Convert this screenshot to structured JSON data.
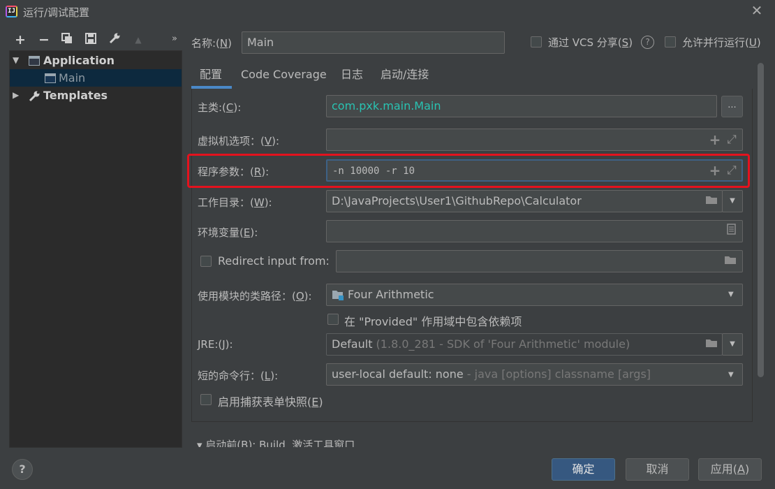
{
  "window": {
    "title": "运行/调试配置",
    "app_icon_text": "IJ"
  },
  "toolbar": {
    "add": "+",
    "remove": "−",
    "copy": "⧉",
    "save": "💾",
    "edit": "🔧",
    "move_up": "▲",
    "more": "»"
  },
  "tree": {
    "items": [
      {
        "label": "Application",
        "expanded": true
      },
      {
        "label": "Main",
        "selected": true
      },
      {
        "label": "Templates",
        "expanded": false
      }
    ]
  },
  "header": {
    "name_label": "名称:(",
    "name_mnemonic": "N",
    "name_label_end": ")",
    "name_value": "Main",
    "share_vcs_label": "通过 VCS 分享(",
    "share_vcs_mnemonic": "S",
    "share_vcs_end": ")",
    "parallel_label": "允许并行运行(",
    "parallel_mnemonic": "U",
    "parallel_end": ")"
  },
  "tabs": [
    {
      "label": "配置",
      "active": true
    },
    {
      "label": "Code Coverage"
    },
    {
      "label": "日志"
    },
    {
      "label": "启动/连接"
    }
  ],
  "form": {
    "main_class": {
      "label": "主类:(",
      "mnemonic": "C",
      "end": "):",
      "value": "com.pxk.main.Main",
      "button": "..."
    },
    "vm_options": {
      "label": "虚拟机选项：(",
      "mnemonic": "V",
      "end": "):",
      "value": ""
    },
    "program_args": {
      "label": "程序参数：(",
      "mnemonic": "R",
      "end": "):",
      "value": "-n 10000 -r 10"
    },
    "working_dir": {
      "label": "工作目录：(",
      "mnemonic": "W",
      "end": "):",
      "value": "D:\\JavaProjects\\User1\\GithubRepo\\Calculator"
    },
    "env_vars": {
      "label": "环境变量(",
      "mnemonic": "E",
      "end": "):",
      "value": ""
    },
    "redirect_input": {
      "label": "Redirect input from:",
      "value": ""
    },
    "module_classpath": {
      "label": "使用模块的类路径：(",
      "mnemonic": "O",
      "end": "):",
      "value": "Four Arithmetic"
    },
    "include_provided": {
      "label": "在 \"Provided\" 作用域中包含依赖项"
    },
    "jre": {
      "label": "JRE:(",
      "mnemonic": "J",
      "end": "):",
      "value_main": "Default",
      "value_dim": " (1.8.0_281 - SDK of 'Four Arithmetic' module)"
    },
    "shorten_cmd": {
      "label": "短的命令行：(",
      "mnemonic": "L",
      "end": "):",
      "value_main": "user-local default: none",
      "value_dim": " - java [options] classname [args]"
    },
    "capture_snapshots": {
      "label": "启用捕获表单快照(",
      "mnemonic": "E",
      "end": ")"
    }
  },
  "footer": {
    "before_launch": "▾  启动前(B): Build, 激活工具窗口",
    "help": "?",
    "ok": "确定",
    "cancel": "取消",
    "apply_label": "应用(",
    "apply_mnemonic": "A",
    "apply_end": ")"
  },
  "colors": {
    "main_class_text": "#29c3b2",
    "highlight": "#e3121e",
    "primary_button": "#365880"
  }
}
